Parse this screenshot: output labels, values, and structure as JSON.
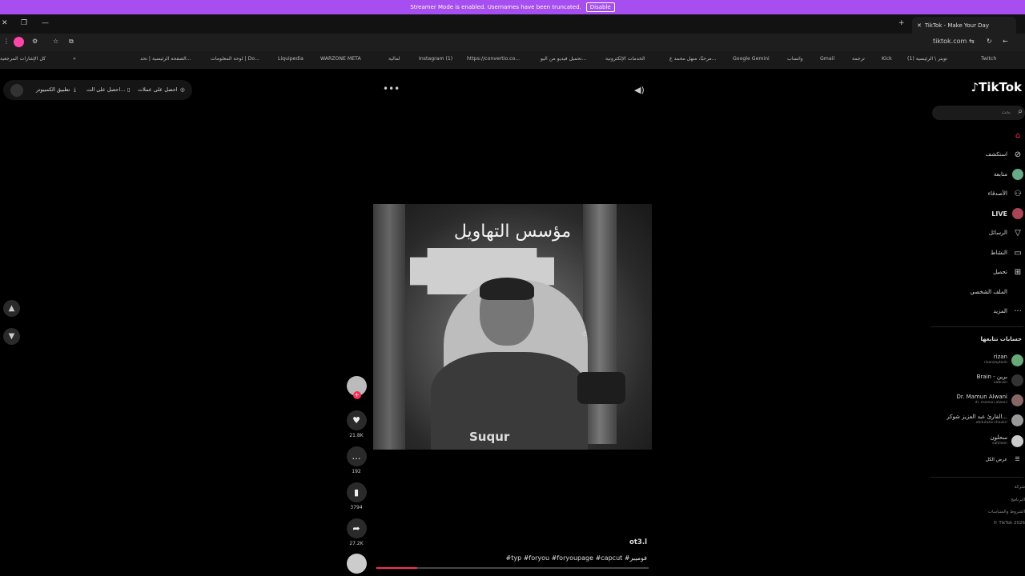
{
  "banner": {
    "text": "Streamer Mode is enabled. Usernames have been truncated.",
    "disable": "Disable"
  },
  "tab": {
    "title": "TikTok - Make Your Day"
  },
  "address": {
    "domain": "tiktok.com"
  },
  "bookmarks": [
    "Twitch",
    "تويتر \\ الرئيسية (1)",
    "Kick",
    "ترجمة",
    "Gmail",
    "واتساب",
    "Google Gemini",
    "مرحبًا، منهل محمد ع...",
    "الخدمات الإلكترونية",
    "تحميل فيديو من اليو...",
    "https://convertio.co...",
    "Instagram (1)",
    "لمالية",
    "WARZONE META",
    "Liquipedia",
    "لوحة المعلومات | Do...",
    "الصفحة الرئيسية | تحد...",
    "كل الإشارات المرجعية"
  ],
  "top_pill": {
    "item1": "احصل على عملات",
    "item2": "احصل على الت...",
    "item3": "تطبيق الكمبيوتر"
  },
  "video": {
    "caption": "مؤسس التهاويل",
    "shirt": "Suqur"
  },
  "actions": {
    "likes": "21.8K",
    "comments": "192",
    "saves": "3794",
    "shares": "27.2K"
  },
  "post": {
    "author": "ot3.l",
    "hashtags": "#typ #foryou #foryoupage #capcut #فوميبر",
    "progress": 0.15
  },
  "sidebar": {
    "logo": "TikTok",
    "search_placeholder": "بحث",
    "nav": [
      {
        "label": "",
        "icon": "home-icon"
      },
      {
        "label": "استكشف",
        "icon": "compass-icon"
      },
      {
        "label": "متابعة",
        "icon": "following-icon"
      },
      {
        "label": "الأصدقاء",
        "icon": "friends-icon"
      },
      {
        "label": "LIVE",
        "icon": "live-icon"
      },
      {
        "label": "الرسائل",
        "icon": "send-icon"
      },
      {
        "label": "النشاط",
        "icon": "activity-icon"
      },
      {
        "label": "تحميل",
        "icon": "upload-icon"
      },
      {
        "label": "الملف الشخصي",
        "icon": "profile-icon"
      },
      {
        "label": "المزيد",
        "icon": "more-icon"
      }
    ],
    "following_title": "حسابات تتابعها",
    "accounts": [
      {
        "name": "rizan",
        "handle": "rizanzaytonh"
      },
      {
        "name": "Brain - برين",
        "handle": "oabrain"
      },
      {
        "name": "Dr. Mamun Alwani",
        "handle": "dr..mamun.alwani"
      },
      {
        "name": "القارئ عبد العزيز شوكر...",
        "handle": "abdulaziz.choukri"
      },
      {
        "name": "سحلون",
        "handle": "sahiloon"
      }
    ],
    "see_all": "عرض الكل",
    "footer": [
      "شركة",
      "البرنامج",
      "الشروط والسياسات",
      "© TikTok 2026"
    ]
  }
}
